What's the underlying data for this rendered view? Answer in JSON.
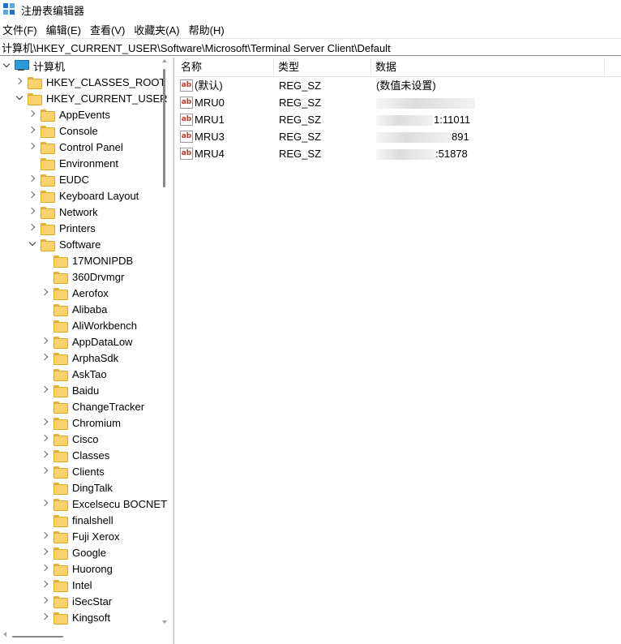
{
  "window": {
    "title": "注册表编辑器",
    "icon": "registry-editor-icon"
  },
  "menubar": {
    "items": [
      "文件(F)",
      "编辑(E)",
      "查看(V)",
      "收藏夹(A)",
      "帮助(H)"
    ]
  },
  "address": {
    "path": "计算机\\HKEY_CURRENT_USER\\Software\\Microsoft\\Terminal Server Client\\Default"
  },
  "tree": {
    "root": "计算机",
    "hives": [
      "HKEY_CLASSES_ROOT",
      "HKEY_CURRENT_USER"
    ],
    "hkcu_children": [
      "AppEvents",
      "Console",
      "Control Panel",
      "Environment",
      "EUDC",
      "Keyboard Layout",
      "Network",
      "Printers",
      "Software"
    ],
    "software_children": [
      "17MONIPDB",
      "360Drvmgr",
      "Aerofox",
      "Alibaba",
      "AliWorkbench",
      "AppDataLow",
      "ArphaSdk",
      "AskTao",
      "Baidu",
      "ChangeTracker",
      "Chromium",
      "Cisco",
      "Classes",
      "Clients",
      "DingTalk",
      "Excelsecu BOCNET",
      "finalshell",
      "Fuji Xerox",
      "Google",
      "Huorong",
      "Intel",
      "iSecStar",
      "Kingsoft"
    ]
  },
  "list": {
    "columns": [
      "名称",
      "类型",
      "数据"
    ],
    "rows": [
      {
        "name": "(默认)",
        "type": "REG_SZ",
        "data": "(数值未设置)",
        "data_tail": ""
      },
      {
        "name": "MRU0",
        "type": "REG_SZ",
        "data": "",
        "data_tail": ""
      },
      {
        "name": "MRU1",
        "type": "REG_SZ",
        "data": "",
        "data_tail": "1:11011"
      },
      {
        "name": "MRU3",
        "type": "REG_SZ",
        "data": "",
        "data_tail": "891"
      },
      {
        "name": "MRU4",
        "type": "REG_SZ",
        "data": "",
        "data_tail": ":51878"
      }
    ],
    "value_icon_text": "ab"
  }
}
